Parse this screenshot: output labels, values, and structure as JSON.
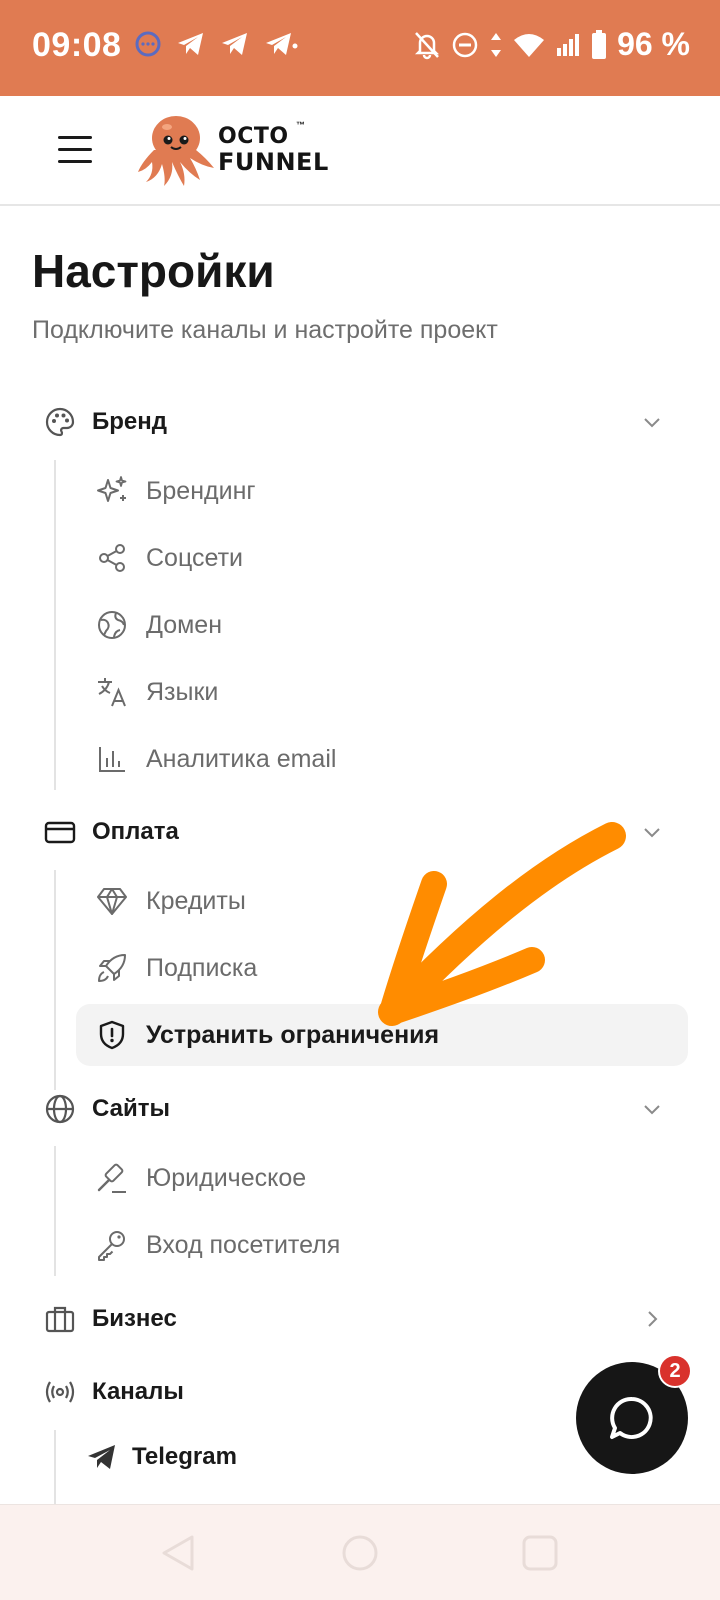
{
  "status_bar": {
    "time": "09:08",
    "battery_text": "96 %"
  },
  "header": {
    "logo_line1": "OCTO",
    "logo_line2": "FUNNEL",
    "logo_tm": "™"
  },
  "page": {
    "title": "Настройки",
    "subtitle": "Подключите каналы и настройте проект"
  },
  "menu": {
    "brand": {
      "label": "Бренд",
      "items": [
        {
          "label": "Брендинг",
          "icon": "sparkles-icon"
        },
        {
          "label": "Соцсети",
          "icon": "share-icon"
        },
        {
          "label": "Домен",
          "icon": "globe-grid-icon"
        },
        {
          "label": "Языки",
          "icon": "translate-icon"
        },
        {
          "label": "Аналитика email",
          "icon": "bar-chart-icon"
        }
      ]
    },
    "payment": {
      "label": "Оплата",
      "items": [
        {
          "label": "Кредиты",
          "icon": "diamond-icon"
        },
        {
          "label": "Подписка",
          "icon": "rocket-icon"
        },
        {
          "label": "Устранить ограничения",
          "icon": "shield-alert-icon"
        }
      ]
    },
    "sites": {
      "label": "Сайты",
      "items": [
        {
          "label": "Юридическое",
          "icon": "gavel-icon"
        },
        {
          "label": "Вход посетителя",
          "icon": "key-icon"
        }
      ]
    },
    "business": {
      "label": "Бизнес"
    },
    "channels": {
      "label": "Каналы",
      "sub": {
        "label": "Telegram"
      }
    }
  },
  "chat": {
    "badge_count": "2"
  },
  "colors": {
    "status_bar": "#e07b52",
    "accent_arrow": "#ff8c00",
    "badge": "#d9322c",
    "fab": "#161616"
  }
}
